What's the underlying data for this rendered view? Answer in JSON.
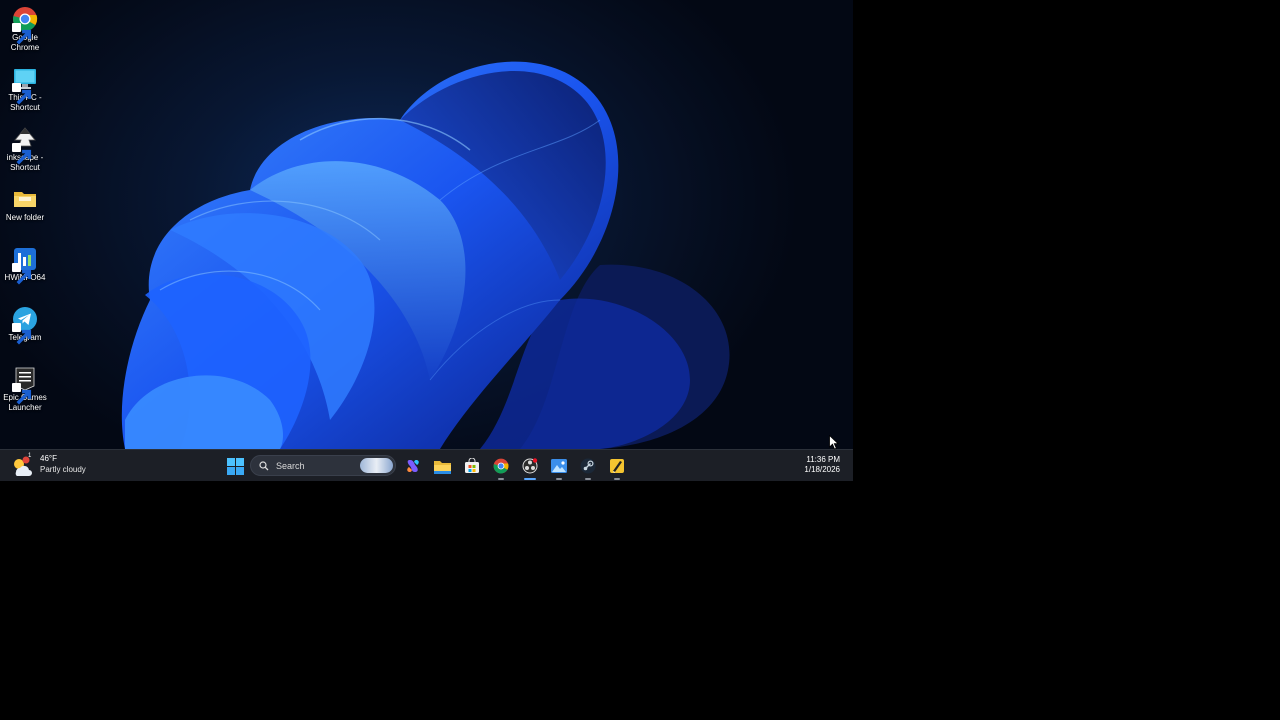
{
  "desktop": {
    "icons": [
      {
        "label": "Google Chrome",
        "icon": "chrome-icon"
      },
      {
        "label": "This PC - Shortcut",
        "icon": "this-pc-icon"
      },
      {
        "label": "inkscape - Shortcut",
        "icon": "inkscape-icon"
      },
      {
        "label": "New folder",
        "icon": "folder-icon"
      },
      {
        "label": "HWiNFO64",
        "icon": "hwinfo-icon"
      },
      {
        "label": "Telegram",
        "icon": "telegram-icon"
      },
      {
        "label": "Epic Games Launcher",
        "icon": "epic-games-icon"
      }
    ]
  },
  "taskbar": {
    "weather": {
      "temperature": "46°F",
      "condition": "Partly cloudy",
      "alert_badge": "1"
    },
    "search": {
      "placeholder": "Search"
    },
    "pinned": [
      "start-icon",
      "copilot-icon",
      "file-explorer-icon",
      "microsoft-store-icon",
      "chrome-icon",
      "obs-icon",
      "photos-icon",
      "steam-icon",
      "inkscape-icon"
    ],
    "clock": {
      "time": "11:36 PM",
      "date": "1/18/2026"
    }
  },
  "colors": {
    "taskbar": "#1c1f26",
    "wallpaper_accent": "#1e5cff",
    "active_indicator": "#5aa7ff"
  }
}
